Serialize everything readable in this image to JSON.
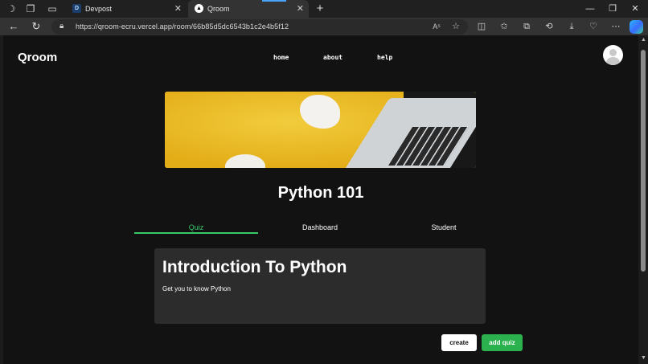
{
  "browser": {
    "tabs": [
      {
        "title": "Devpost",
        "favicon_letter": "D",
        "active": false
      },
      {
        "title": "Qroom",
        "favicon_letter": "▲",
        "active": true
      }
    ],
    "url": "https://qroom-ecru.vercel.app/room/66b85d5dc6543b1c2e4b5f12",
    "read_aloud_label": "A⁵"
  },
  "site": {
    "logo": "Qroom",
    "nav": {
      "home": "home",
      "about": "about",
      "help": "help"
    }
  },
  "room": {
    "title": "Python 101",
    "tabs": {
      "quiz": "Quiz",
      "dashboard": "Dashboard",
      "student": "Student"
    },
    "selected_tab": "Quiz"
  },
  "quiz_card": {
    "title": "Introduction To Python",
    "description": "Get you to know Python"
  },
  "actions": {
    "create": "create",
    "add_quiz": "add quiz"
  },
  "colors": {
    "accent_green": "#38c96b",
    "button_green": "#2bb24f",
    "banner_yellow": "#e9b824"
  }
}
